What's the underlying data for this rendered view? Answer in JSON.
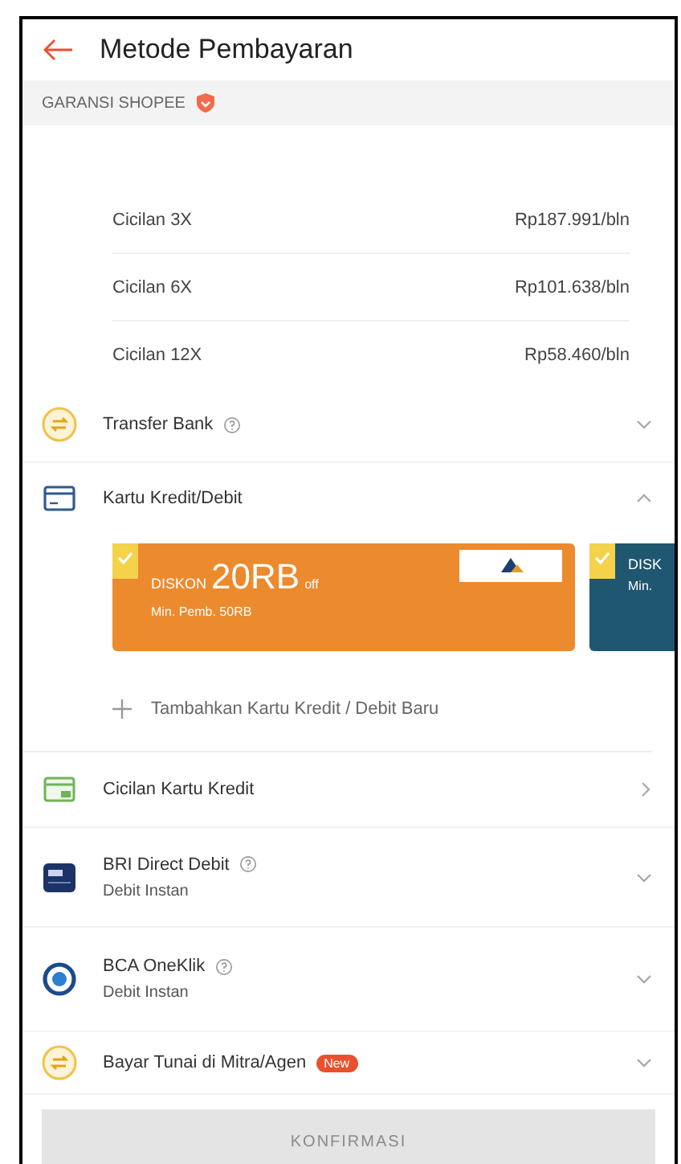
{
  "header": {
    "title": "Metode Pembayaran"
  },
  "guarantee": {
    "label": "GARANSI SHOPEE"
  },
  "installments": [
    {
      "label": "Cicilan 3X",
      "amount": "Rp187.991/bln"
    },
    {
      "label": "Cicilan 6X",
      "amount": "Rp101.638/bln"
    },
    {
      "label": "Cicilan 12X",
      "amount": "Rp58.460/bln"
    }
  ],
  "methods": [
    {
      "name": "Transfer Bank",
      "info": true,
      "kind": "expand",
      "expanded": false
    },
    {
      "name": "Kartu Kredit/Debit",
      "info": false,
      "kind": "expand",
      "expanded": true,
      "vouchers": [
        {
          "color": "#ec8a2e",
          "prefix": "DISKON",
          "amount": "20RB",
          "suffix": "off",
          "min": "Min. Pemb. 50RB"
        },
        {
          "color": "#1f5670",
          "prefix": "DISK",
          "min": "Min."
        }
      ],
      "add_card": "Tambahkan Kartu Kredit / Debit Baru"
    },
    {
      "name": "Cicilan Kartu Kredit",
      "info": false,
      "kind": "link"
    },
    {
      "name": "BRI Direct Debit",
      "info": true,
      "kind": "expand",
      "expanded": false,
      "subtitle": "Debit Instan"
    },
    {
      "name": "BCA OneKlik",
      "info": true,
      "kind": "expand",
      "expanded": false,
      "subtitle": "Debit Instan"
    },
    {
      "name": "Bayar Tunai di Mitra/Agen",
      "info": false,
      "badge": "New",
      "kind": "expand",
      "expanded": false
    }
  ],
  "confirm": {
    "label": "KONFIRMASI",
    "disabled": true
  }
}
